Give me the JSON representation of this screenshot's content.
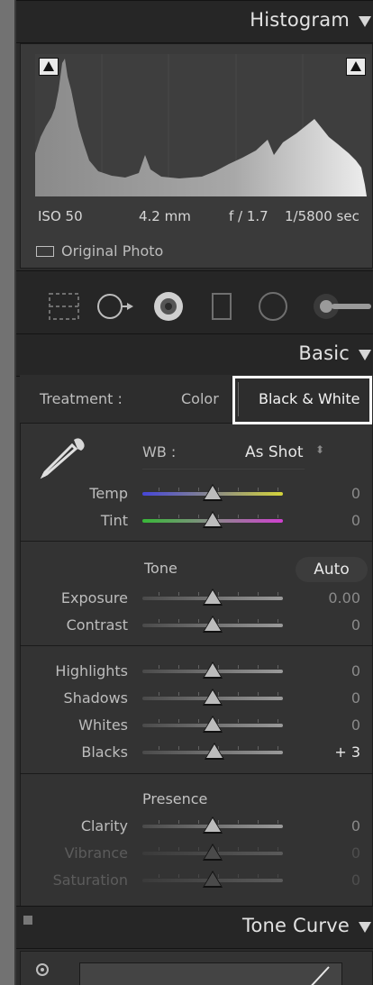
{
  "histogram": {
    "title": "Histogram",
    "iso": "ISO 50",
    "focal_length": "4.2 mm",
    "aperture": "f / 1.7",
    "shutter": "1/5800 sec",
    "original_photo_label": "Original Photo"
  },
  "tools": [
    "crop-overlay-icon",
    "spot-removal-icon",
    "red-eye-icon",
    "graduated-filter-icon",
    "radial-filter-icon",
    "adjustment-brush-icon"
  ],
  "basic": {
    "title": "Basic",
    "treatment_label": "Treatment :",
    "treatment_options": [
      "Color",
      "Black & White"
    ],
    "treatment_selected": "Black & White",
    "wb_label": "WB :",
    "wb_value": "As Shot",
    "tone_label": "Tone",
    "auto_label": "Auto",
    "presence_label": "Presence",
    "sliders": {
      "temp": {
        "label": "Temp",
        "value": "0",
        "position": 0.5
      },
      "tint": {
        "label": "Tint",
        "value": "0",
        "position": 0.5
      },
      "exposure": {
        "label": "Exposure",
        "value": "0.00",
        "position": 0.5
      },
      "contrast": {
        "label": "Contrast",
        "value": "0",
        "position": 0.5
      },
      "highlights": {
        "label": "Highlights",
        "value": "0",
        "position": 0.5
      },
      "shadows": {
        "label": "Shadows",
        "value": "0",
        "position": 0.5
      },
      "whites": {
        "label": "Whites",
        "value": "0",
        "position": 0.5
      },
      "blacks": {
        "label": "Blacks",
        "value": "+ 3",
        "position": 0.51
      },
      "clarity": {
        "label": "Clarity",
        "value": "0",
        "position": 0.5
      },
      "vibrance": {
        "label": "Vibrance",
        "value": "0",
        "position": 0.5
      },
      "saturation": {
        "label": "Saturation",
        "value": "0",
        "position": 0.5
      }
    }
  },
  "tone_curve": {
    "title": "Tone Curve"
  },
  "colors": {
    "panel_bg": "#2b2b2b",
    "header_bg": "#262626",
    "highlight_border": "#fafafa"
  }
}
